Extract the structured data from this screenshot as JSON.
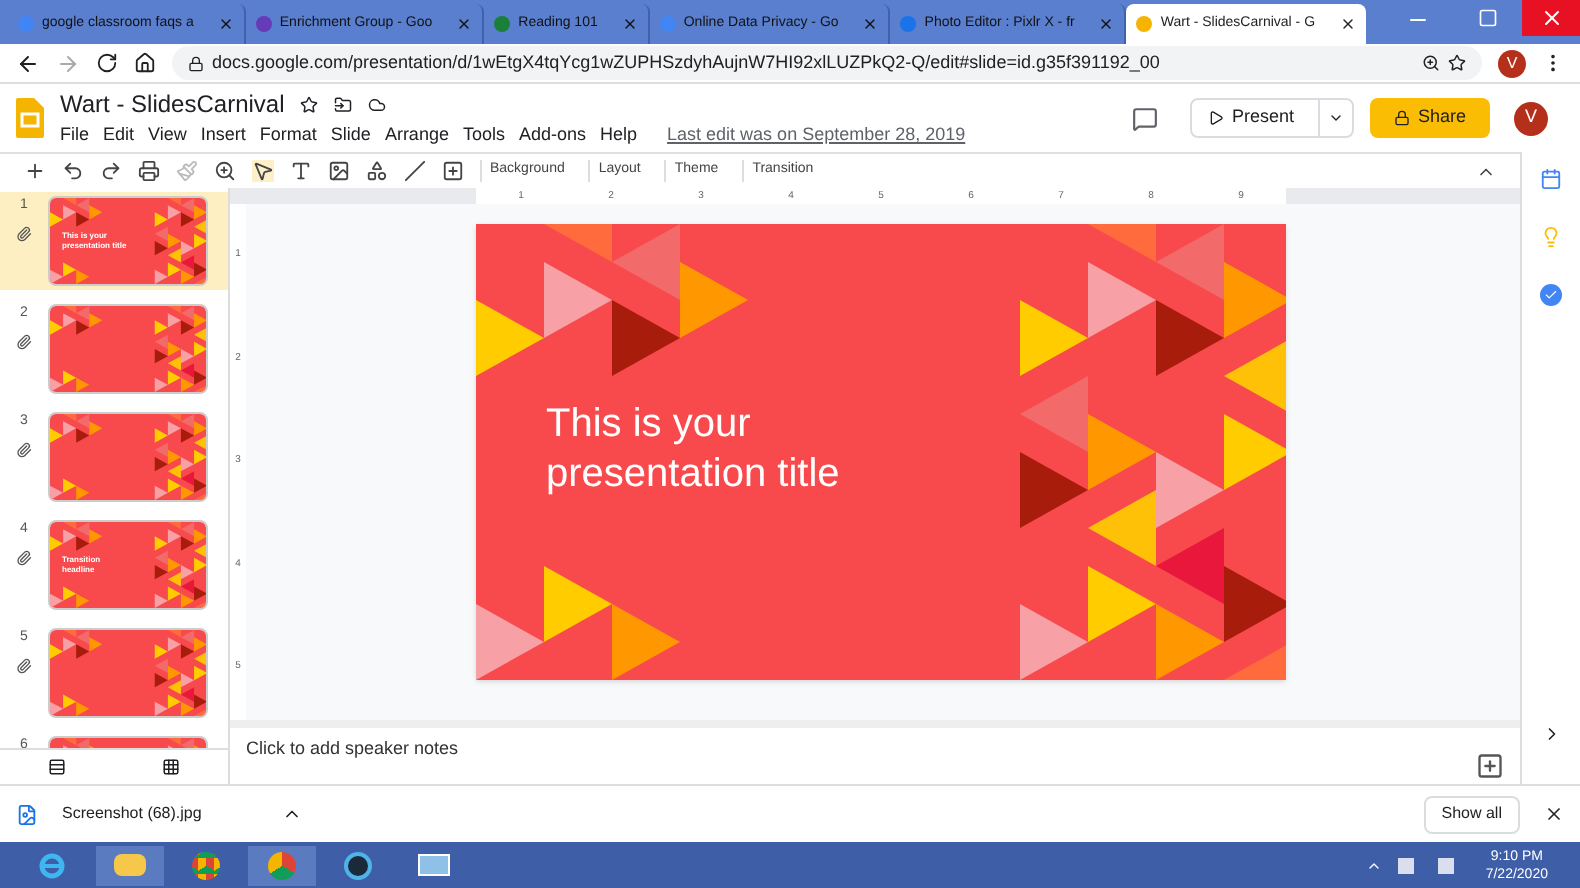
{
  "browser_tabs": [
    {
      "title": "google classroom faqs a",
      "color": "#4285f4",
      "selected": false
    },
    {
      "title": "Enrichment Group - Goo",
      "color": "#673ab7",
      "selected": false
    },
    {
      "title": "Reading 101",
      "color": "#188038",
      "selected": false
    },
    {
      "title": "Online Data Privacy - Go",
      "color": "#4285f4",
      "selected": false
    },
    {
      "title": "Photo Editor : Pixlr X - fr",
      "color": "#1a73e8",
      "selected": false
    },
    {
      "title": "Wart - SlidesCarnival - G",
      "color": "#f4b400",
      "selected": true
    }
  ],
  "address_bar": {
    "url": "docs.google.com/presentation/d/1wEtgX4tqYcg1wZUPHSzdyhAujnW7HI92xlLUZPkQ2-Q/edit#slide=id.g35f391192_00",
    "profile": "V"
  },
  "document": {
    "title": "Wart - SlidesCarnival",
    "menu": [
      "File",
      "Edit",
      "View",
      "Insert",
      "Format",
      "Slide",
      "Arrange",
      "Tools",
      "Add-ons",
      "Help"
    ],
    "last_edit": "Last edit was on September 28, 2019",
    "present": "Present",
    "share": "Share",
    "account": "V"
  },
  "toolbar": {
    "buttons": [
      "Background",
      "Layout",
      "Theme",
      "Transition"
    ]
  },
  "ruler": {
    "horizontal": [
      "1",
      "2",
      "3",
      "4",
      "5",
      "6",
      "7",
      "8",
      "9"
    ],
    "vertical": [
      "1",
      "2",
      "3",
      "4",
      "5"
    ]
  },
  "filmstrip": [
    {
      "number": "1",
      "selected": true,
      "title": "This is your presentation title"
    },
    {
      "number": "2",
      "selected": false
    },
    {
      "number": "3",
      "selected": false
    },
    {
      "number": "4",
      "selected": false,
      "title": "Transition headline"
    },
    {
      "number": "5",
      "selected": false
    },
    {
      "number": "6",
      "selected": false
    }
  ],
  "slide": {
    "title": "This is your presentation title"
  },
  "speaker_notes": {
    "placeholder": "Click to add speaker notes"
  },
  "download_bar": {
    "file": "Screenshot (68).jpg",
    "show_all": "Show all"
  },
  "taskbar": {
    "time": "9:10 PM",
    "date": "7/22/2020"
  }
}
